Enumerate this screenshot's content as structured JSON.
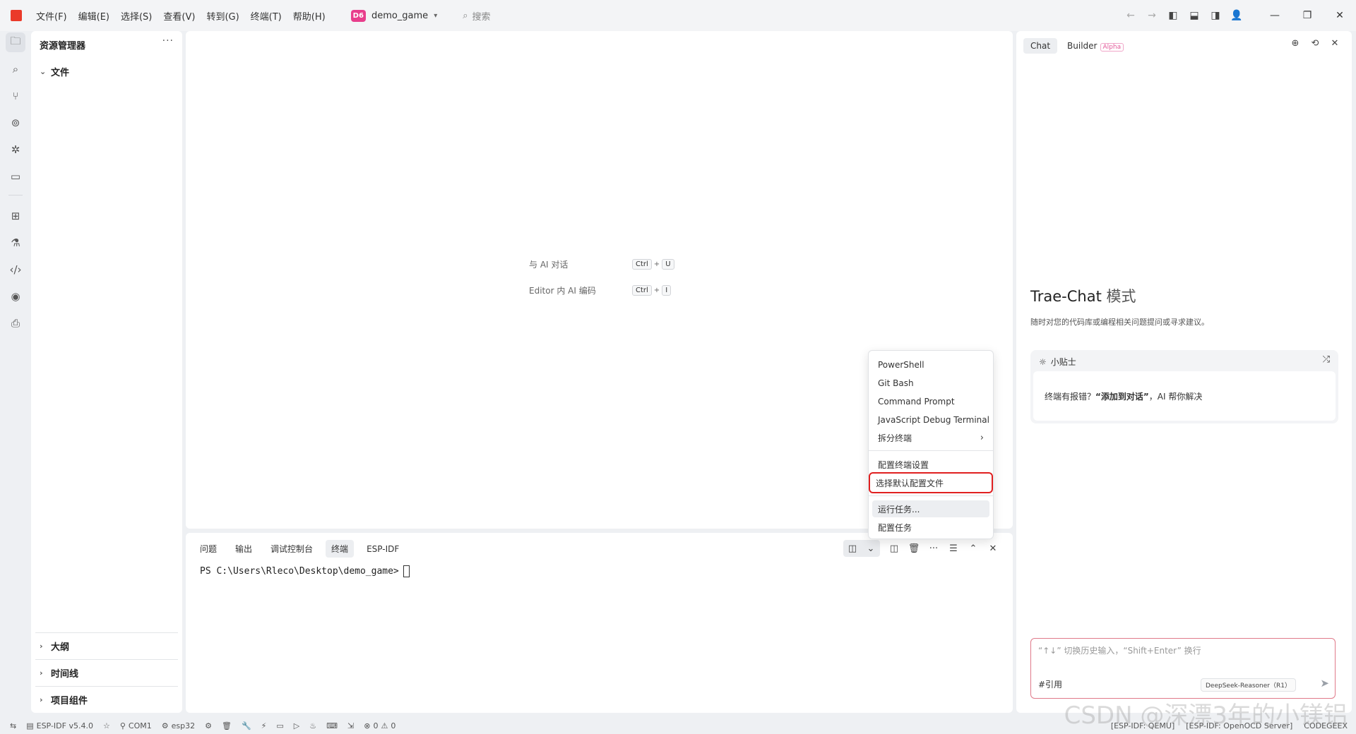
{
  "menu": [
    "文件(F)",
    "编辑(E)",
    "选择(S)",
    "查看(V)",
    "转到(G)",
    "终端(T)",
    "帮助(H)"
  ],
  "project": {
    "badge": "D6",
    "name": "demo_game"
  },
  "search": {
    "label": "搜索"
  },
  "sidebar": {
    "title": "资源管理器",
    "more": "···",
    "files_section": "文件",
    "bottom_sections": [
      "大纲",
      "时间线",
      "项目组件"
    ]
  },
  "editor": {
    "hints": [
      {
        "label": "与 AI 对话",
        "keys": [
          "Ctrl",
          "U"
        ]
      },
      {
        "label": "Editor 内 AI 编码",
        "keys": [
          "Ctrl",
          "I"
        ]
      }
    ]
  },
  "panel": {
    "tabs": [
      "问题",
      "输出",
      "调试控制台",
      "终端",
      "ESP-IDF"
    ],
    "active_tab": "终端",
    "terminal_prompt": "PS C:\\Users\\Rleco\\Desktop\\demo_game>"
  },
  "dropdown": {
    "items": [
      "PowerShell",
      "Git Bash",
      "Command Prompt",
      "JavaScript Debug Terminal",
      "拆分终端",
      "配置终端设置",
      "选择默认配置文件",
      "运行任务...",
      "配置任务"
    ],
    "highlighted": "选择默认配置文件",
    "hovered": "运行任务..."
  },
  "chat": {
    "tabs": [
      "Chat",
      "Builder"
    ],
    "alpha_badge": "Alpha",
    "title_main": "Trae-Chat",
    "title_mode": "模式",
    "subtitle": "随时对您的代码库或编程相关问题提问或寻求建议。",
    "tip_title": "小贴士",
    "tip_prefix": "终端有报错？",
    "tip_bold": "“添加到对话”",
    "tip_suffix": "，AI 帮你解决",
    "input_placeholder": "“↑↓” 切换历史输入，“Shift+Enter” 换行",
    "cite_label": "#引用",
    "model": "DeepSeek-Reasoner（R1）"
  },
  "statusbar": {
    "esp_idf": "ESP-IDF v5.4.0",
    "port": "COM1",
    "target": "esp32",
    "errors": "0",
    "warnings": "0",
    "right": [
      "[ESP-IDF: QEMU]",
      "[ESP-IDF: OpenOCD Server]",
      "CODEGEEX"
    ]
  },
  "watermark": "CSDN @深漂3年的小镁铝",
  "colors": {
    "accent_red": "#e02020",
    "logo": "#ea3a2a",
    "badge_pink": "#e83e8c"
  }
}
